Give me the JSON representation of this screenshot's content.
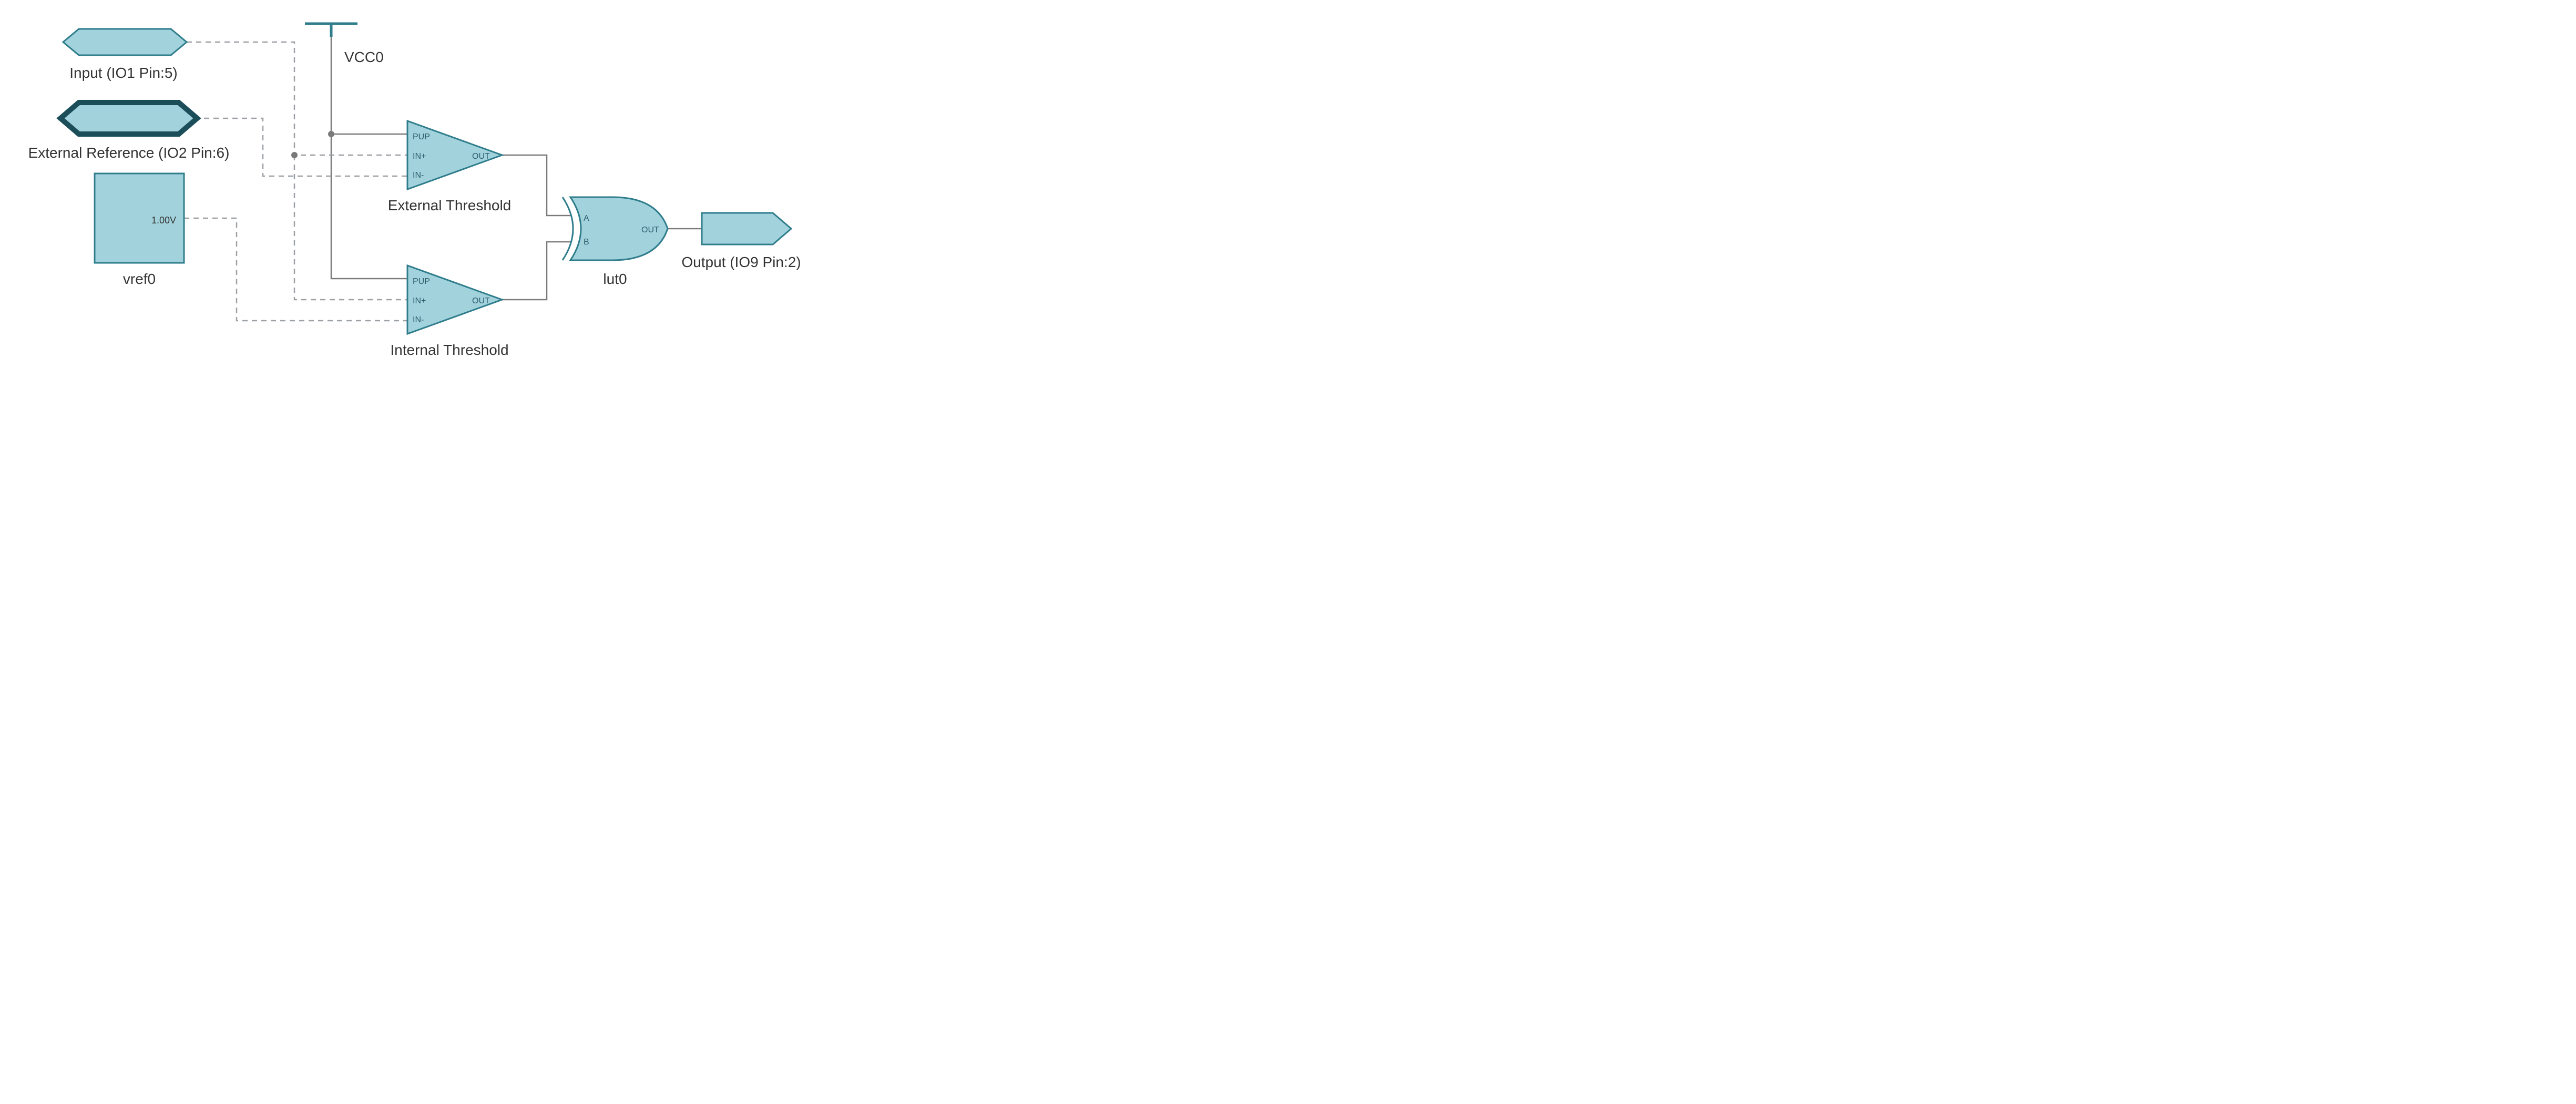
{
  "blocks": {
    "input": {
      "label": "Input (IO1 Pin:5)"
    },
    "extref": {
      "label": "External Reference (IO2 Pin:6)"
    },
    "vref": {
      "label": "vref0",
      "value": "1.00V"
    },
    "vcc": {
      "label": "VCC0"
    },
    "comp1": {
      "label": "External Threshold",
      "pins": {
        "pup": "PUP",
        "inp": "IN+",
        "inn": "IN-",
        "out": "OUT"
      }
    },
    "comp2": {
      "label": "Internal Threshold",
      "pins": {
        "pup": "PUP",
        "inp": "IN+",
        "inn": "IN-",
        "out": "OUT"
      }
    },
    "lut": {
      "label": "lut0",
      "pins": {
        "a": "A",
        "b": "B",
        "out": "OUT"
      }
    },
    "output": {
      "label": "Output (IO9 Pin:2)"
    }
  },
  "colors": {
    "fill": "#a2d3dc",
    "stroke": "#2f7d8c",
    "darkStroke": "#1c4e5a",
    "wire": "#7a7a7a",
    "dash": "#9aa0a6",
    "junction": "#7a7a7a"
  }
}
